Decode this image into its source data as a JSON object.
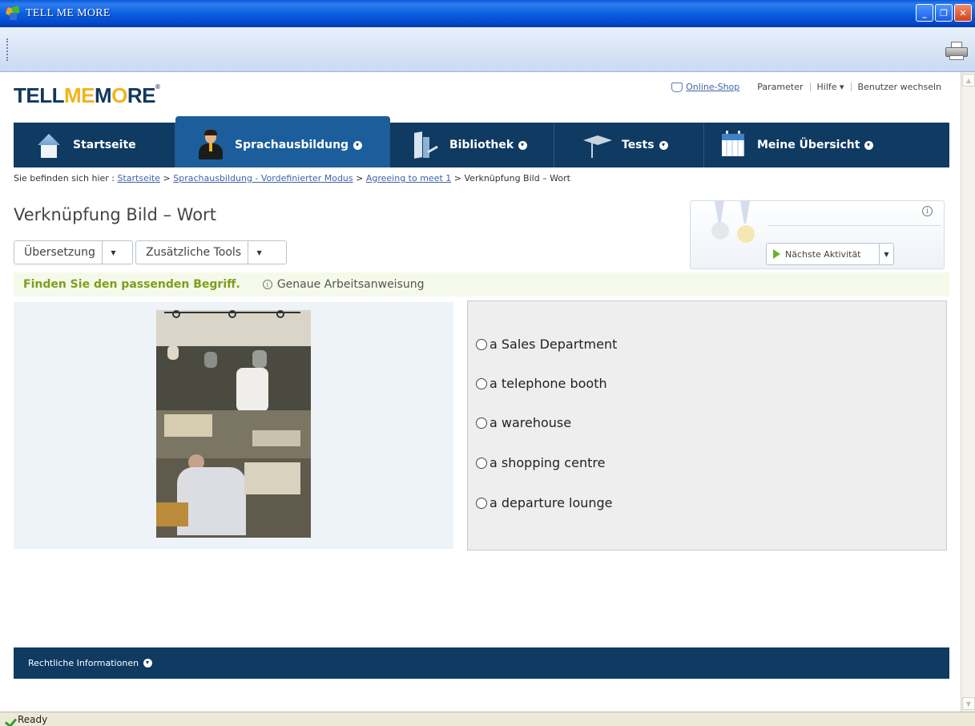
{
  "window": {
    "title": "TELL ME MORE"
  },
  "logo": {
    "part1": "TELL",
    "part2": "ME",
    "part3": "M",
    "part4": "O",
    "part5": "RE",
    "mark": "®"
  },
  "top_links": {
    "shop": "Online-Shop",
    "parameter": "Parameter",
    "help": "Hilfe ▾",
    "switch_user": "Benutzer wechseln"
  },
  "nav": {
    "tabs": [
      {
        "label": "Startseite",
        "icon": "home-icon"
      },
      {
        "label": "Sprachausbildung",
        "icon": "student-icon",
        "active": true
      },
      {
        "label": "Bibliothek",
        "icon": "library-icon"
      },
      {
        "label": "Tests",
        "icon": "graduation-cap-icon"
      },
      {
        "label": "Meine Übersicht",
        "icon": "calendar-icon"
      }
    ]
  },
  "breadcrumb": {
    "prefix": "Sie befinden sich hier :",
    "items": [
      "Startseite",
      "Sprachausbildung - Vordefinierter Modus",
      "Agreeing to meet 1"
    ],
    "current": "Verknüpfung Bild – Wort",
    "separator": ">"
  },
  "page": {
    "title": "Verknüpfung Bild – Wort",
    "translation_label": "Übersetzung",
    "tools_label": "Zusätzliche Tools",
    "next_activity_label": "Nächste Aktivität"
  },
  "instruction": {
    "main": "Finden Sie den passenden Begriff.",
    "detail": "Genaue Arbeitsanweisung"
  },
  "options": [
    "a Sales Department",
    "a telephone booth",
    "a warehouse",
    "a shopping centre",
    "a departure lounge"
  ],
  "footer": {
    "legal": "Rechtliche Informationen"
  },
  "status": {
    "text": "Ready"
  },
  "colors": {
    "nav_bg": "#0f3a62",
    "nav_active": "#1c5e9c",
    "logo_accent": "#f2b41b",
    "instruction_green": "#7e9e1e"
  }
}
